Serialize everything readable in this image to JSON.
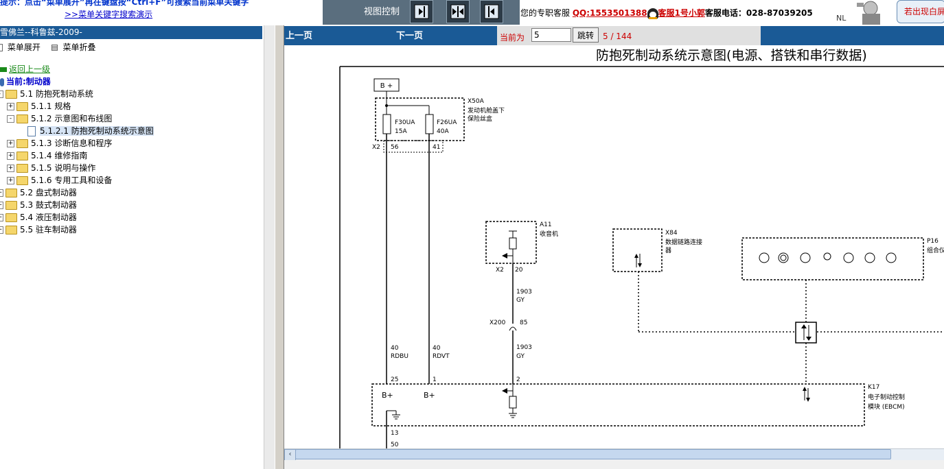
{
  "header": {
    "tip_text": "提示：点击“菜单展开”再在键盘按“Ctrl+F”可搜索当前菜单关键字",
    "demo_link": ">>菜单关键字搜索演示",
    "view_control_label": "视图控制",
    "support_prefix": "您的专职客服",
    "qq": "QQ:1553501388",
    "kefu": "客服1号小郭",
    "phone_label": "客服电话：",
    "phone": "028-87039205",
    "nl": "NL",
    "exit": "若出现白屏"
  },
  "left_panel": {
    "title": "雪佛兰--科鲁兹-2009-",
    "expand_label": "菜单展开",
    "collapse_label": "菜单折叠",
    "back_link": "返回上一级",
    "current_label": "当前:制动器",
    "tree": [
      {
        "label": "5.1 防抱死制动系统",
        "level": 0,
        "sign": "-"
      },
      {
        "label": "5.1.1 规格",
        "level": 1,
        "sign": "+"
      },
      {
        "label": "5.1.2 示意图和布线图",
        "level": 1,
        "sign": "-"
      },
      {
        "label": "5.1.2.1 防抱死制动系统示意图",
        "level": 2,
        "sign": ""
      },
      {
        "label": "5.1.3 诊断信息和程序",
        "level": 1,
        "sign": "+"
      },
      {
        "label": "5.1.4 维修指南",
        "level": 1,
        "sign": "+"
      },
      {
        "label": "5.1.5 说明与操作",
        "level": 1,
        "sign": "+"
      },
      {
        "label": "5.1.6 专用工具和设备",
        "level": 1,
        "sign": "+"
      },
      {
        "label": "5.2 盘式制动器",
        "level": 0,
        "sign": "+"
      },
      {
        "label": "5.3 鼓式制动器",
        "level": 0,
        "sign": "+"
      },
      {
        "label": "5.4 液压制动器",
        "level": 0,
        "sign": "+"
      },
      {
        "label": "5.5 驻车制动器",
        "level": 0,
        "sign": "+"
      }
    ]
  },
  "nav": {
    "prev": "上一页",
    "next": "下一页",
    "current_label": "当前为",
    "current_value": "5",
    "jump": "跳转",
    "page_count": "5 / 144"
  },
  "diagram": {
    "title": "防抱死制动系统示意图(电源、搭铁和串行数据)",
    "b_plus": "B +",
    "x50a": "X50A",
    "x50a_desc1": "发动机舱盖下",
    "x50a_desc2": "保险丝盒",
    "f30": "F30UA",
    "f30_amp": "15A",
    "f26": "F26UA",
    "f26_amp": "40A",
    "x2": "X2",
    "pin56": "56",
    "pin41": "41",
    "a11": "A11",
    "a11_desc": "收音机",
    "a11_x2": "X2",
    "a11_pin": "20",
    "wire1903a": "1903",
    "gy_a": "GY",
    "x200": "X200",
    "x200_pin": "85",
    "wire1903b": "1903",
    "gy_b": "GY",
    "x84": "X84",
    "x84_desc1": "数据链路连接",
    "x84_desc2": "器",
    "p16": "P16",
    "p16_desc": "组合仪",
    "w40a": "40",
    "rdbu": "RDBU",
    "w40b": "40",
    "rdvt": "RDVT",
    "pin25": "25",
    "pin1": "1",
    "pin2": "2",
    "bplus1": "B+",
    "bplus2": "B+",
    "k17": "K17",
    "k17_desc1": "电子制动控制",
    "k17_desc2": "模块 (EBCM)",
    "pin13": "13",
    "pin50": "50"
  }
}
